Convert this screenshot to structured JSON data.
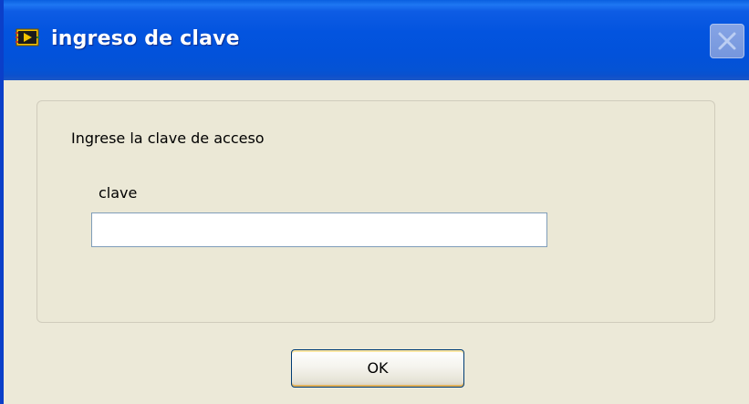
{
  "window": {
    "title": "ingreso de clave",
    "app_icon": "labview-vi-icon",
    "close_icon": "close-icon"
  },
  "dialog": {
    "prompt": "Ingrese la clave de acceso",
    "field_label": "clave",
    "field_value": "",
    "ok_label": "OK"
  },
  "colors": {
    "titlebar": "#0354DF",
    "client_background": "#ECE9D8",
    "input_border": "#7F9DB9"
  }
}
